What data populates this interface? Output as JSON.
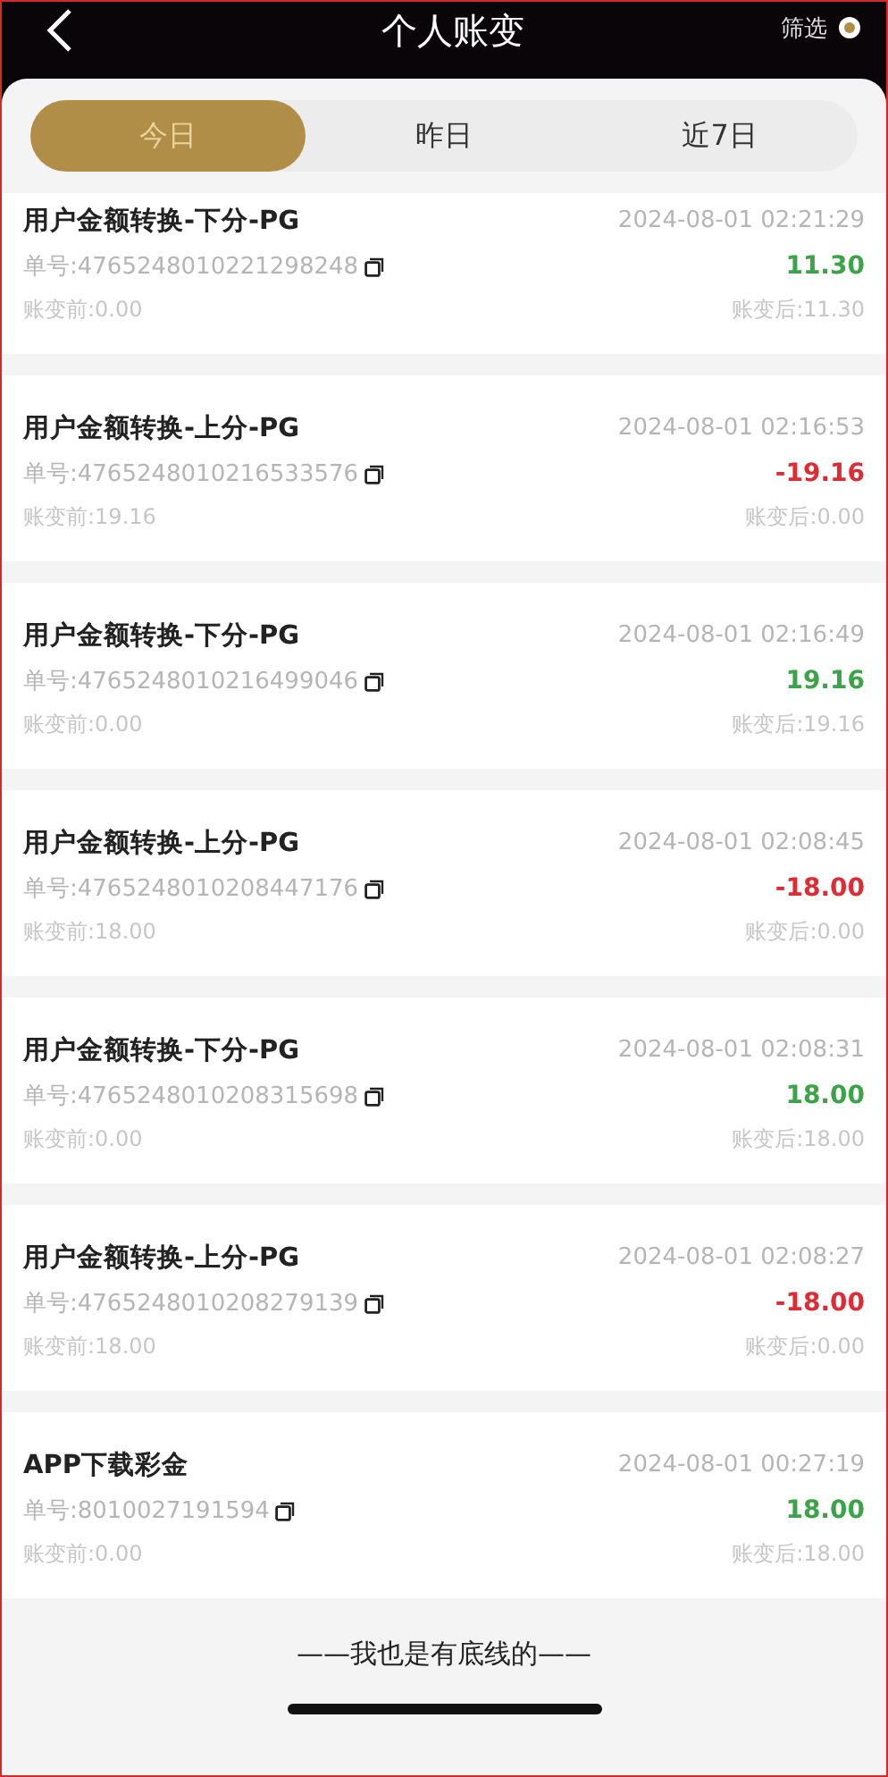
{
  "header": {
    "title": "个人账变",
    "filter": "筛选"
  },
  "tabs": [
    {
      "label": "今日",
      "selected": true
    },
    {
      "label": "昨日",
      "selected": false
    },
    {
      "label": "近7日",
      "selected": false
    }
  ],
  "records": [
    {
      "title": "用户金额转换-下分-PG",
      "time": "2024-08-01 02:21:29",
      "order": "单号:4765248010221298248",
      "amount": "11.30",
      "kind": "credit",
      "before": "账变前:0.00",
      "after": "账变后:11.30"
    },
    {
      "title": "用户金额转换-上分-PG",
      "time": "2024-08-01 02:16:53",
      "order": "单号:4765248010216533576",
      "amount": "-19.16",
      "kind": "debit",
      "before": "账变前:19.16",
      "after": "账变后:0.00"
    },
    {
      "title": "用户金额转换-下分-PG",
      "time": "2024-08-01 02:16:49",
      "order": "单号:4765248010216499046",
      "amount": "19.16",
      "kind": "credit",
      "before": "账变前:0.00",
      "after": "账变后:19.16"
    },
    {
      "title": "用户金额转换-上分-PG",
      "time": "2024-08-01 02:08:45",
      "order": "单号:4765248010208447176",
      "amount": "-18.00",
      "kind": "debit",
      "before": "账变前:18.00",
      "after": "账变后:0.00"
    },
    {
      "title": "用户金额转换-下分-PG",
      "time": "2024-08-01 02:08:31",
      "order": "单号:4765248010208315698",
      "amount": "18.00",
      "kind": "credit",
      "before": "账变前:0.00",
      "after": "账变后:18.00"
    },
    {
      "title": "用户金额转换-上分-PG",
      "time": "2024-08-01 02:08:27",
      "order": "单号:4765248010208279139",
      "amount": "-18.00",
      "kind": "debit",
      "before": "账变前:18.00",
      "after": "账变后:0.00"
    },
    {
      "title": "APP下载彩金",
      "time": "2024-08-01 00:27:19",
      "order": "单号:8010027191594",
      "amount": "18.00",
      "kind": "credit",
      "before": "账变前:0.00",
      "after": "账变后:18.00"
    }
  ],
  "footer": "——我也是有底线的——"
}
